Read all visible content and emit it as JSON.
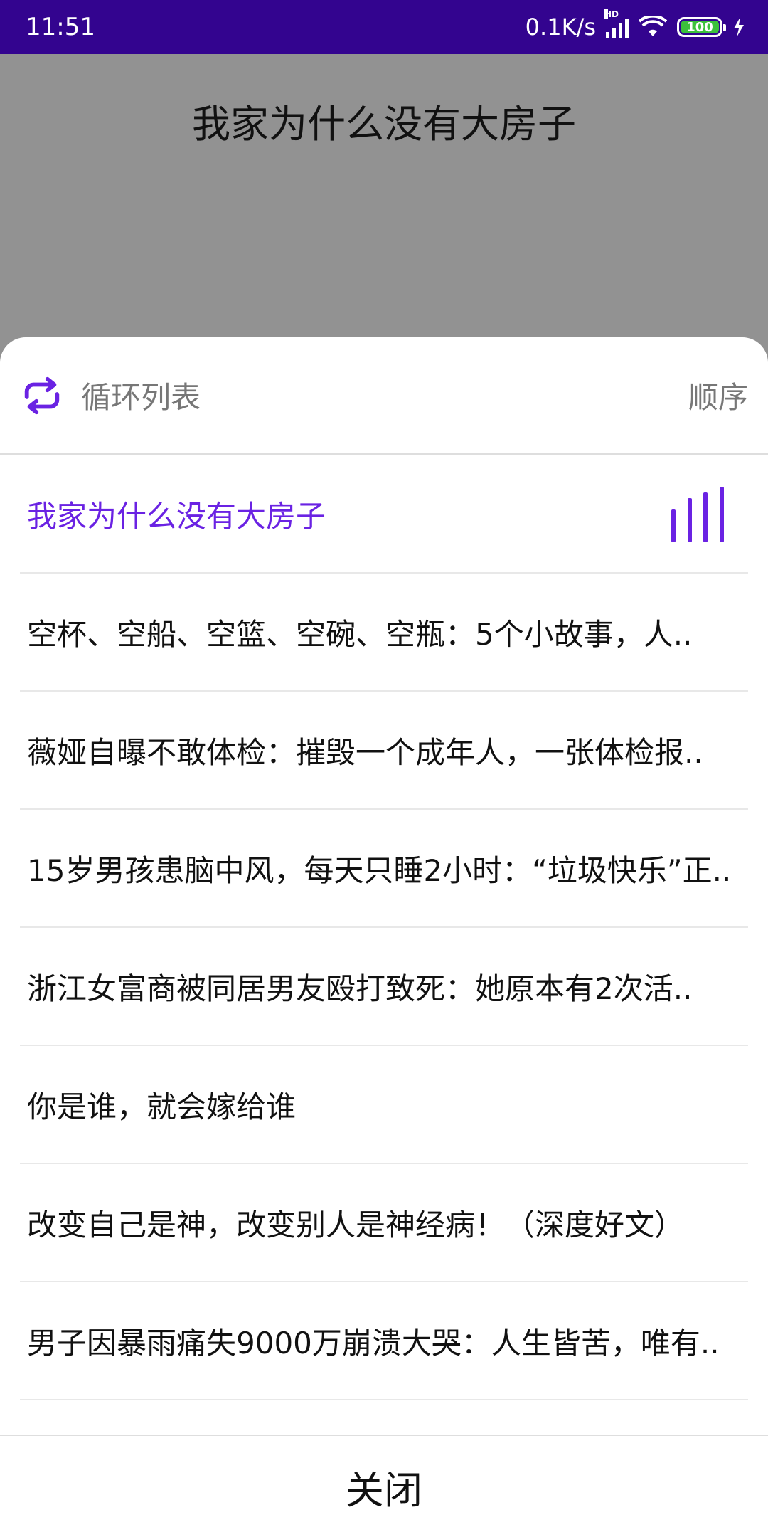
{
  "status_bar": {
    "time": "11:51",
    "net_speed": "0.1K/s",
    "network_badge": "HD",
    "battery": "100"
  },
  "now_playing_title": "我家为什么没有大房子",
  "sheet": {
    "loop_label": "循环列表",
    "order_label": "顺序",
    "items": [
      {
        "title": "我家为什么没有大房子",
        "active": true
      },
      {
        "title": "空杯、空船、空篮、空碗、空瓶：5个小故事，人..",
        "active": false
      },
      {
        "title": "薇娅自曝不敢体检：摧毁一个成年人，一张体检报..",
        "active": false
      },
      {
        "title": "15岁男孩患脑中风，每天只睡2小时：“垃圾快乐”正..",
        "active": false
      },
      {
        "title": "浙江女富商被同居男友殴打致死：她原本有2次活..",
        "active": false
      },
      {
        "title": "你是谁，就会嫁给谁",
        "active": false
      },
      {
        "title": "改变自己是神，改变别人是神经病！（深度好文）",
        "active": false
      },
      {
        "title": "男子因暴雨痛失9000万崩溃大哭：人生皆苦，唯有..",
        "active": false
      }
    ],
    "close_label": "关闭"
  },
  "colors": {
    "status_bar": "#33048f",
    "accent": "#6a22e3",
    "dim_backdrop": "#929292"
  },
  "icons": {
    "loop": "repeat-icon",
    "playing": "equalizer-icon"
  }
}
